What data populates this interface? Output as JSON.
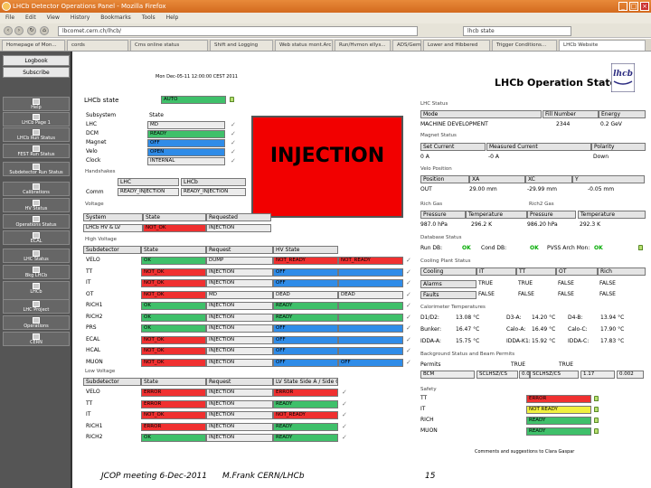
{
  "window": {
    "title": "LHCb Detector Operations Panel - Mozilla Firefox",
    "buttons": [
      "_",
      "□",
      "×"
    ]
  },
  "menu": [
    "File",
    "Edit",
    "View",
    "History",
    "Bookmarks",
    "Tools",
    "Help"
  ],
  "nav": {
    "url": "lbcomet.cern.ch/lhcb/",
    "search": "lhcb state"
  },
  "tabs": [
    "Homepage of Mon...",
    "cords",
    "Cms online status",
    "Shift and Logging",
    "Web status mont.Arc",
    "Run/Hvmon ellys...",
    "ADS/Gemini/A",
    "Lower and Hibbered",
    "Trigger Conditions...",
    "LHCb Website"
  ],
  "sidebar": {
    "top": [
      "Logbook",
      "Subscribe"
    ],
    "items": [
      "Help",
      "LHCb Page 1",
      "LHCb Run Status",
      "FEST Run Status",
      "Subdetector Run Status",
      "Calibrations",
      "HV Status",
      "Operations Status",
      "ECAL",
      "LHC Status",
      "Bkg LHCb",
      "LHCb",
      "LHC Project",
      "Operations",
      "CERN"
    ]
  },
  "header": {
    "title": "LHCb Operation State",
    "timestamp": "Mon Dec-05-11 12:00:00 CEST 2011"
  },
  "lhc_state": {
    "label": "LHCb state",
    "value": "AUTO",
    "injection": "INJECTION"
  },
  "subsystems": {
    "head": [
      "Subsystem",
      "State"
    ],
    "rows": [
      [
        "LHC",
        "MD"
      ],
      [
        "DCM",
        "READY"
      ],
      [
        "Magnet",
        "OFF"
      ],
      [
        "Velo",
        "OPEN"
      ],
      [
        "Clock",
        "INTERNAL"
      ]
    ]
  },
  "handshakes": {
    "label": "Handshakes",
    "cols": [
      "LHC",
      "LHCb"
    ],
    "row": [
      "Comm",
      "READY_INJECTION",
      "READY_INJECTION"
    ]
  },
  "voltage": {
    "label": "Voltage",
    "head": [
      "System",
      "State",
      "Requested"
    ],
    "row": [
      "LHCb HV & LV",
      "NOT_OK",
      "INJECTION"
    ]
  },
  "high_voltage": {
    "label": "High Voltage",
    "head": [
      "Subdetector",
      "State",
      "Request",
      "HV State"
    ],
    "rows": [
      [
        "VELO",
        "OK",
        "DUMP",
        "NOT_READY",
        "NOT_READY"
      ],
      [
        "TT",
        "NOT_OK",
        "INJECTION",
        "OFF",
        ""
      ],
      [
        "IT",
        "NOT_OK",
        "INJECTION",
        "OFF",
        ""
      ],
      [
        "OT",
        "NOT_OK",
        "MD",
        "DEAD",
        "DEAD"
      ],
      [
        "RICH1",
        "OK",
        "INJECTION",
        "READY",
        ""
      ],
      [
        "RICH2",
        "OK",
        "INJECTION",
        "READY",
        ""
      ],
      [
        "PRS",
        "OK",
        "INJECTION",
        "OFF",
        ""
      ],
      [
        "ECAL",
        "NOT_OK",
        "INJECTION",
        "OFF",
        ""
      ],
      [
        "HCAL",
        "NOT_OK",
        "INJECTION",
        "OFF",
        ""
      ],
      [
        "MUON",
        "NOT_OK",
        "INJECTION",
        "OFF",
        "OFF"
      ]
    ]
  },
  "low_voltage": {
    "label": "Low Voltage",
    "head": [
      "Subdetector",
      "State",
      "Request",
      "LV State Side A / Side C"
    ],
    "rows": [
      [
        "VELO",
        "ERROR",
        "INJECTION",
        "ERROR"
      ],
      [
        "TT",
        "ERROR",
        "INJECTION",
        "READY"
      ],
      [
        "IT",
        "NOT_OK",
        "INJECTION",
        "NOT_READY"
      ],
      [
        "RICH1",
        "ERROR",
        "INJECTION",
        "READY"
      ],
      [
        "RICH2",
        "OK",
        "INJECTION",
        "READY"
      ]
    ]
  },
  "lhc_status": {
    "label": "LHC Status",
    "head": [
      "Mode",
      "Fill Number",
      "Energy"
    ],
    "row": [
      "MACHINE DEVELOPMENT",
      "2344",
      "0.2 GeV"
    ]
  },
  "magnet": {
    "label": "Magnet Status",
    "head": [
      "Set Current",
      "Measured Current",
      "Polarity"
    ],
    "row": [
      "0 A",
      "-0 A",
      "Down"
    ]
  },
  "velo": {
    "label": "Velo Position",
    "head": [
      "Position",
      "XA",
      "XC",
      "Y"
    ],
    "row": [
      "OUT",
      "29.00 mm",
      "-29.99 mm",
      "-0.05 mm"
    ]
  },
  "gas": {
    "label_a": "Rich Gas",
    "label_b": "Rich2 Gas",
    "head": [
      "Pressure",
      "Temperature",
      "Pressure",
      "Temperature"
    ],
    "row": [
      "987.0 hPa",
      "296.2 K",
      "986.20 hPa",
      "292.3 K"
    ]
  },
  "database": {
    "label": "Database Status",
    "items": [
      [
        "Run DB:",
        "OK"
      ],
      [
        "Cond DB:",
        "OK"
      ],
      [
        "PVSS Arch Mon:",
        "OK"
      ]
    ]
  },
  "cooling": {
    "label": "Cooling Plant Status",
    "head": [
      "Cooling",
      "IT",
      "TT",
      "OT",
      "Rich"
    ],
    "rows": [
      [
        "Alarms",
        "TRUE",
        "TRUE",
        "FALSE",
        "FALSE"
      ],
      [
        "Faults",
        "FALSE",
        "FALSE",
        "FALSE",
        "FALSE"
      ]
    ]
  },
  "temps": {
    "label": "Calorimeter Temperatures",
    "rows": [
      [
        "D1/D2:",
        "13.08 °C",
        "D3-A:",
        "14.20 °C",
        "D4-B:",
        "13.94 °C"
      ],
      [
        "Bunker:",
        "16.47 °C",
        "Calo-A:",
        "16.49 °C",
        "Calo-C:",
        "17.90 °C"
      ],
      [
        "IDDA-A:",
        "15.75 °C",
        "IDDA-K1:",
        "15.92 °C",
        "IDDA-C:",
        "17.83 °C"
      ]
    ]
  },
  "background": {
    "label": "Background Status and Beam Permits",
    "head": [
      "Permits",
      "",
      "TRUE",
      "TRUE"
    ],
    "row": [
      "BCM",
      "SCLHSZ/CS",
      "0.01",
      "SCLHSZ/CS",
      "1.17",
      "0.002"
    ]
  },
  "safety": {
    "label": "Safety",
    "rows": [
      [
        "TT",
        "ERROR"
      ],
      [
        "IT",
        "NOT READY"
      ],
      [
        "RICH",
        "READY"
      ],
      [
        "MUON",
        "READY"
      ]
    ]
  },
  "note": "Comments and suggestions to Clara Gaspar",
  "footer": {
    "meeting": "JCOP meeting 6-Dec-2011",
    "author": "M.Frank CERN/LHCb",
    "page": "15"
  },
  "colors": {
    "ok": "#3fc06a",
    "bad": "#f03030",
    "off": "#2f8ce8",
    "injection": "#f20000"
  }
}
